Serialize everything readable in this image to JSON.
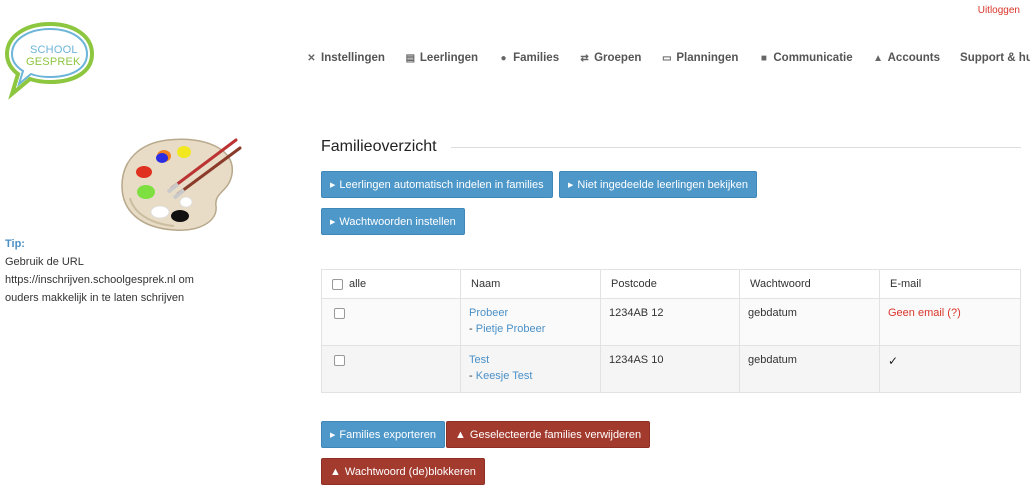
{
  "header": {
    "logout_label": "Uitloggen",
    "logo": {
      "line1": "SCHOOL",
      "line2": "GESPREK"
    }
  },
  "nav": [
    {
      "icon": "tools-icon",
      "label": "Instellingen"
    },
    {
      "icon": "id-card-icon",
      "label": "Leerlingen"
    },
    {
      "icon": "users-icon",
      "label": "Families"
    },
    {
      "icon": "shuffle-icon",
      "label": "Groepen"
    },
    {
      "icon": "calendar-icon",
      "label": "Planningen"
    },
    {
      "icon": "chat-icon",
      "label": "Communicatie"
    },
    {
      "icon": "lock-icon",
      "label": "Accounts"
    },
    {
      "icon": "",
      "label": "Support & hulp"
    }
  ],
  "sidebar": {
    "tip_label": "Tip:",
    "tip_text_1": "Gebruik de URL",
    "tip_text_2": "https://inschrijven.schoolgesprek.nl om",
    "tip_text_3": "ouders makkelijk in te laten schrijven"
  },
  "main": {
    "title": "Familieoverzicht",
    "buttons": {
      "auto_assign": "Leerlingen automatisch indelen in families",
      "unassigned": "Niet ingedeelde leerlingen bekijken",
      "set_passwords": "Wachtwoorden instellen",
      "export": "Families exporteren",
      "delete_selected": "Geselecteerde families verwijderen",
      "unblock_password": "Wachtwoord (de)blokkeren"
    },
    "table": {
      "headers": {
        "select_all": "alle",
        "name": "Naam",
        "postcode": "Postcode",
        "password": "Wachtwoord",
        "email": "E-mail"
      },
      "rows": [
        {
          "family": "Probeer",
          "child_prefix": "- ",
          "child": "Pietje Probeer",
          "postcode": "1234AB 12",
          "password": "gebdatum",
          "email": "Geen email (?)",
          "email_ok": false
        },
        {
          "family": "Test",
          "child_prefix": "- ",
          "child": "Keesje Test",
          "postcode": "1234AS 10",
          "password": "gebdatum",
          "email": "✓",
          "email_ok": true
        }
      ]
    }
  },
  "colors": {
    "accent_blue": "#4d97c9",
    "danger_red": "#a33a2e",
    "link_blue": "#4a90c7",
    "logout_red": "#d9352a"
  }
}
